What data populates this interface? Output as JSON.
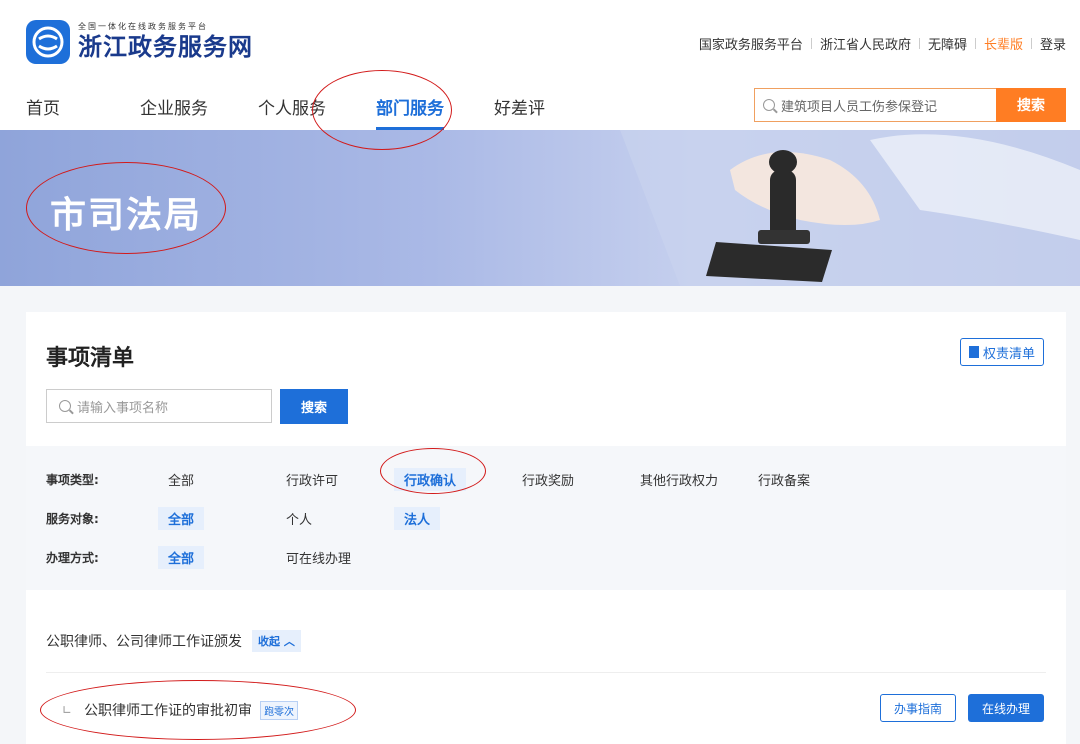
{
  "header": {
    "logo_sub": "全国一体化在线政务服务平台",
    "logo_title": "浙江政务服务网",
    "links": [
      {
        "label": "国家政务服务平台",
        "highlight": false
      },
      {
        "label": "浙江省人民政府",
        "highlight": false
      },
      {
        "label": "无障碍",
        "highlight": false
      },
      {
        "label": "长辈版",
        "highlight": true
      },
      {
        "label": "登录",
        "highlight": false
      }
    ],
    "nav": [
      {
        "label": "首页",
        "active": false
      },
      {
        "label": "企业服务",
        "active": false
      },
      {
        "label": "个人服务",
        "active": false
      },
      {
        "label": "部门服务",
        "active": true
      },
      {
        "label": "好差评",
        "active": false
      }
    ],
    "search_placeholder": "建筑项目人员工伤参保登记",
    "search_button": "搜索"
  },
  "banner": {
    "title": "市司法局"
  },
  "list": {
    "title": "事项清单",
    "rights_button": "权责清单",
    "search_placeholder": "请输入事项名称",
    "search_button": "搜索",
    "filters": [
      {
        "label": "事项类型:",
        "options": [
          {
            "label": "全部",
            "selected": false
          },
          {
            "label": "行政许可",
            "selected": false
          },
          {
            "label": "行政确认",
            "selected": true
          },
          {
            "label": "行政奖励",
            "selected": false
          },
          {
            "label": "其他行政权力",
            "selected": false
          },
          {
            "label": "行政备案",
            "selected": false
          }
        ]
      },
      {
        "label": "服务对象:",
        "options": [
          {
            "label": "全部",
            "selected": true
          },
          {
            "label": "个人",
            "selected": false
          },
          {
            "label": "法人",
            "selected": true
          }
        ]
      },
      {
        "label": "办理方式:",
        "options": [
          {
            "label": "全部",
            "selected": true
          },
          {
            "label": "可在线办理",
            "selected": false
          }
        ]
      }
    ],
    "group_title": "公职律师、公司律师工作证颁发",
    "collapse_label": "收起 ︿",
    "subitem_title": "公职律师工作证的审批初审",
    "subitem_tag": "跑零次",
    "guide_button": "办事指南",
    "online_button": "在线办理"
  },
  "colors": {
    "primary": "#1e6fd9",
    "accent": "#ff7d23",
    "annotation": "#d21a1a"
  }
}
